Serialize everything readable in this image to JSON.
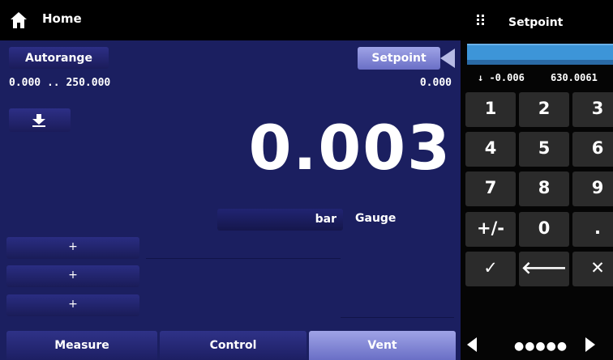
{
  "header": {
    "title": "Home"
  },
  "main": {
    "autorange_label": "Autorange",
    "range_text": "0.000 .. 250.000",
    "setpoint_label": "Setpoint",
    "setpoint_value": "0.000",
    "reading": "0.003",
    "unit": "bar",
    "mode": "Gauge",
    "plus_buttons": [
      "+",
      "+",
      "+"
    ]
  },
  "tabs": [
    {
      "label": "Measure",
      "active": false
    },
    {
      "label": "Control",
      "active": false
    },
    {
      "label": "Vent",
      "active": true
    }
  ],
  "keypad": {
    "title": "Setpoint",
    "min_text": "↓ -0.006",
    "max_text": "630.0061",
    "keys": [
      "1",
      "2",
      "3",
      "4",
      "5",
      "6",
      "7",
      "8",
      "9",
      "+/-",
      "0",
      ".",
      "✓",
      "🡐",
      "✕"
    ],
    "page_dots": "●●●●●"
  },
  "colors": {
    "accent": "#7f84d8",
    "panel_bg": "#1b1f60",
    "input": "#3d95d8"
  }
}
